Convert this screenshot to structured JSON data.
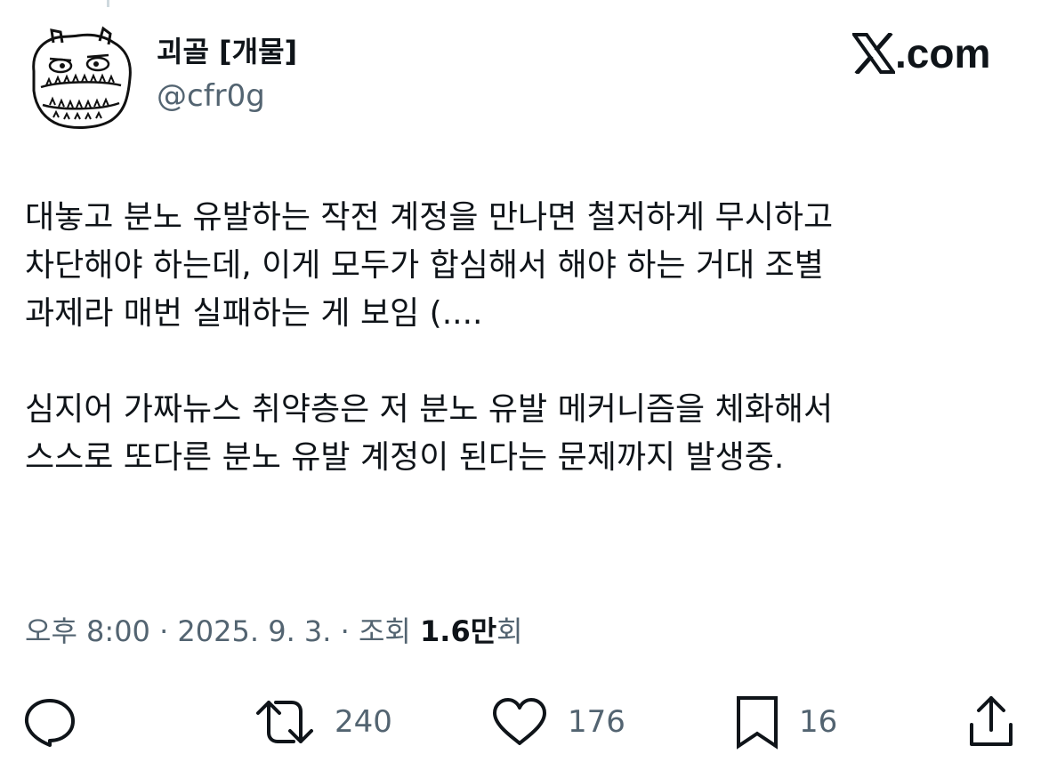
{
  "author": {
    "display_name": "괴골 [개물]",
    "handle": "@cfr0g",
    "avatar_icon": "doodle-monster-avatar"
  },
  "site": {
    "label": ".com",
    "logo_icon": "x-logo-icon"
  },
  "tweet": {
    "lines": [
      "대놓고 분노 유발하는 작전 계정을 만나면 철저하게 무시하고",
      "차단해야 하는데, 이게 모두가 합심해서 해야 하는 거대 조별",
      "과제라 매번 실패하는 게 보임 (....",
      "",
      "심지어 가짜뉴스 취약층은 저 분노 유발 메커니즘을 체화해서",
      "스스로 또다른 분노 유발 계정이 된다는 문제까지 발생중."
    ]
  },
  "meta": {
    "time_date": "오후 8:00 · 2025. 9. 3. · 조회 ",
    "views_number": "1.6",
    "views_unit": "만",
    "views_suffix": "회"
  },
  "actions": {
    "reply": {
      "icon": "reply-icon",
      "count": ""
    },
    "retweet": {
      "icon": "retweet-icon",
      "count": "240"
    },
    "like": {
      "icon": "heart-icon",
      "count": "176"
    },
    "bookmark": {
      "icon": "bookmark-icon",
      "count": "16"
    },
    "share": {
      "icon": "share-icon",
      "count": ""
    }
  },
  "colors": {
    "text_primary": "#0f1419",
    "text_secondary": "#536471",
    "background": "#ffffff"
  }
}
